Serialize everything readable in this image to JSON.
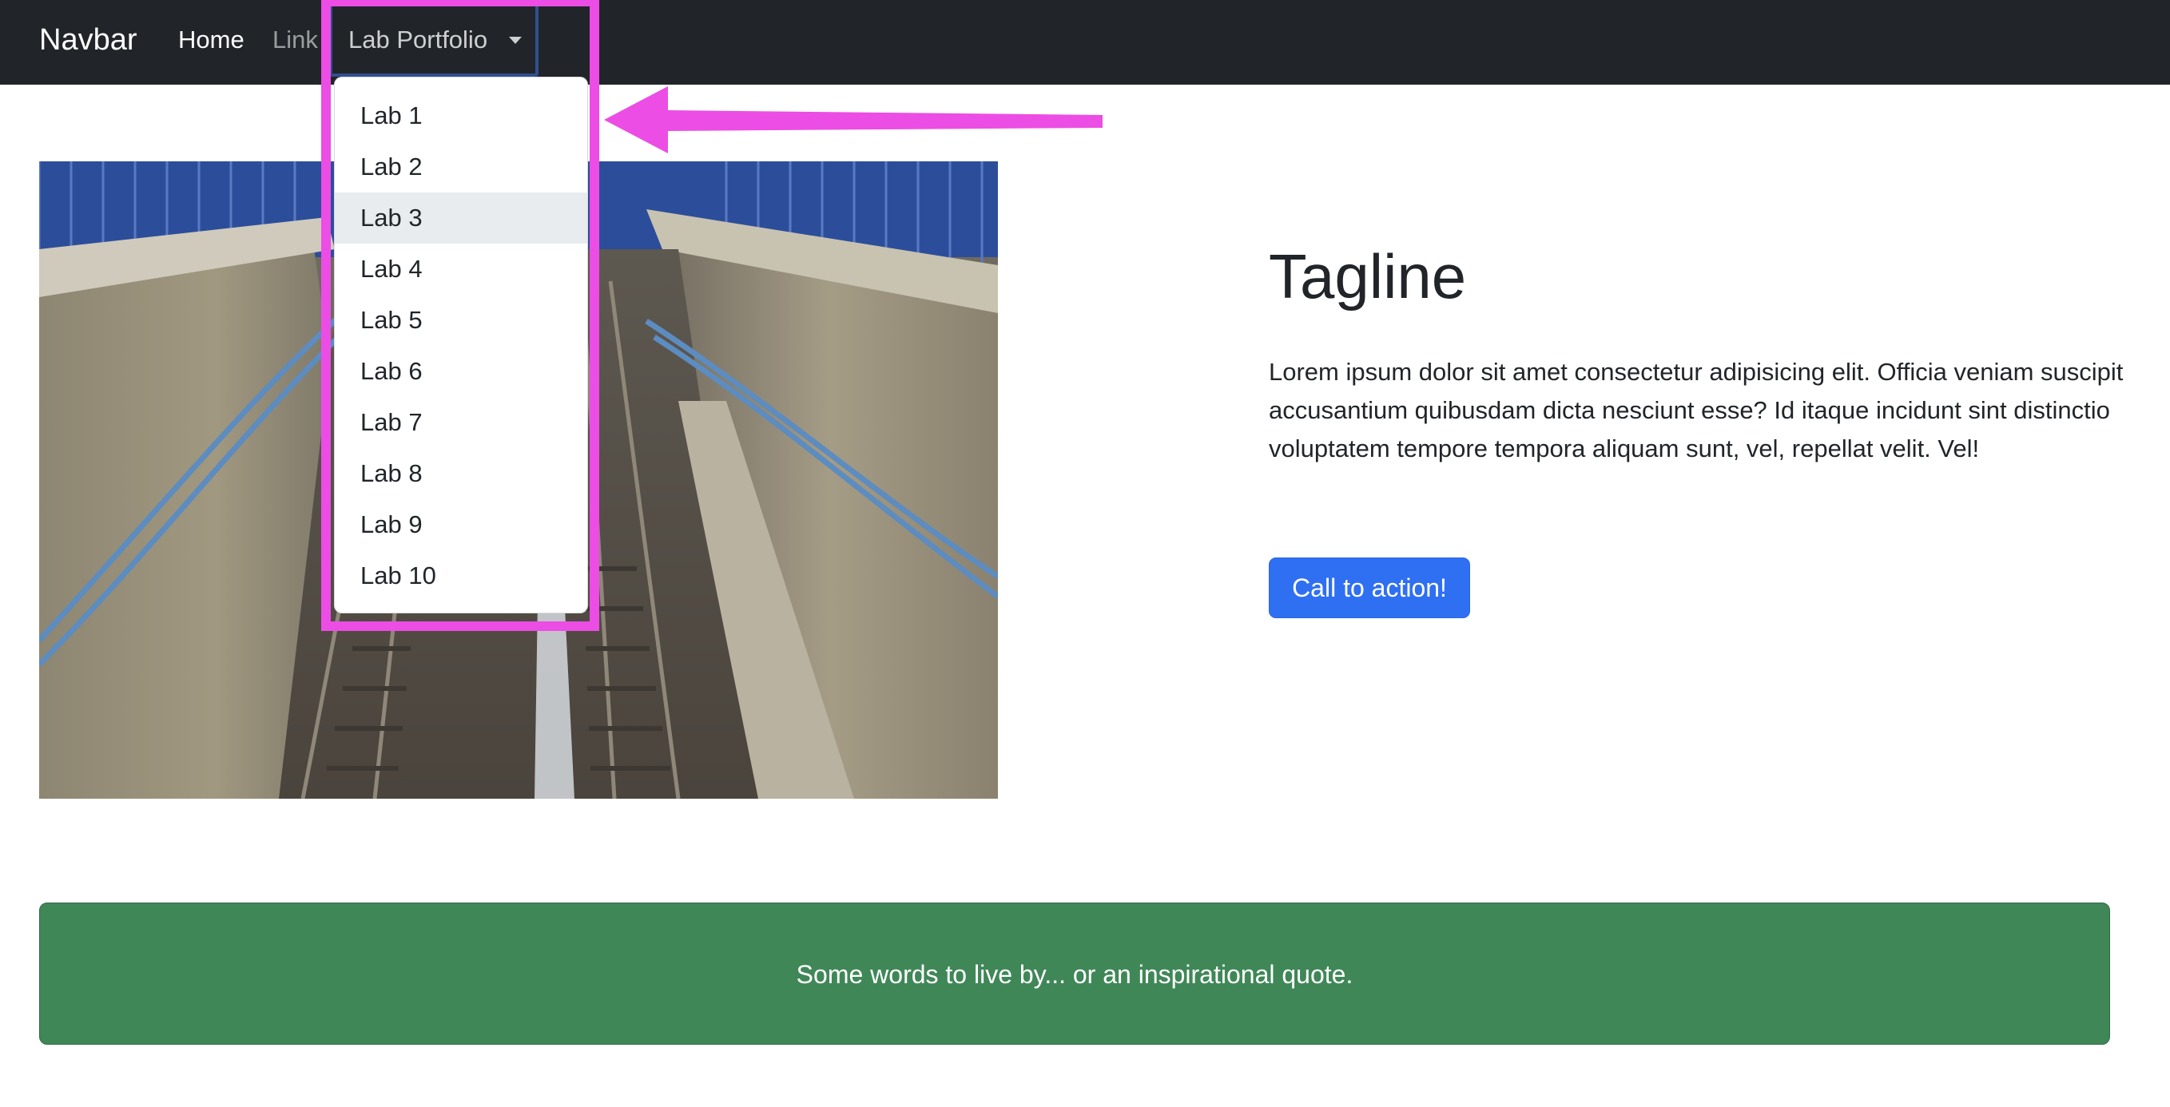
{
  "navbar": {
    "brand": "Navbar",
    "links": [
      "Home",
      "Link"
    ],
    "dropdown_label": "Lab Portfolio",
    "dropdown_open": true,
    "dropdown_items": [
      "Lab 1",
      "Lab 2",
      "Lab 3",
      "Lab 4",
      "Lab 5",
      "Lab 6",
      "Lab 7",
      "Lab 8",
      "Lab 9",
      "Lab 10"
    ],
    "highlighted_item": "Lab 3",
    "background": "#212529"
  },
  "hero": {
    "image_subject": "railway-tracks-photo",
    "tagline": "Tagline",
    "lead": "Lorem ipsum dolor sit amet consectetur adipisicing elit. Officia veniam suscipit accusantium quibusdam dicta nesciunt esse? Id itaque incidunt sint distinctio voluptatem tempore tempora aliquam sunt, vel, repellat velit. Vel!",
    "cta_label": "Call to action!",
    "cta_color": "#2f6ff2"
  },
  "quote": {
    "text": "Some words to live by... or an inspirational quote.",
    "background": "#408758"
  },
  "annotation": {
    "color": "#ec4de4",
    "icon": "arrow-left-icon"
  }
}
